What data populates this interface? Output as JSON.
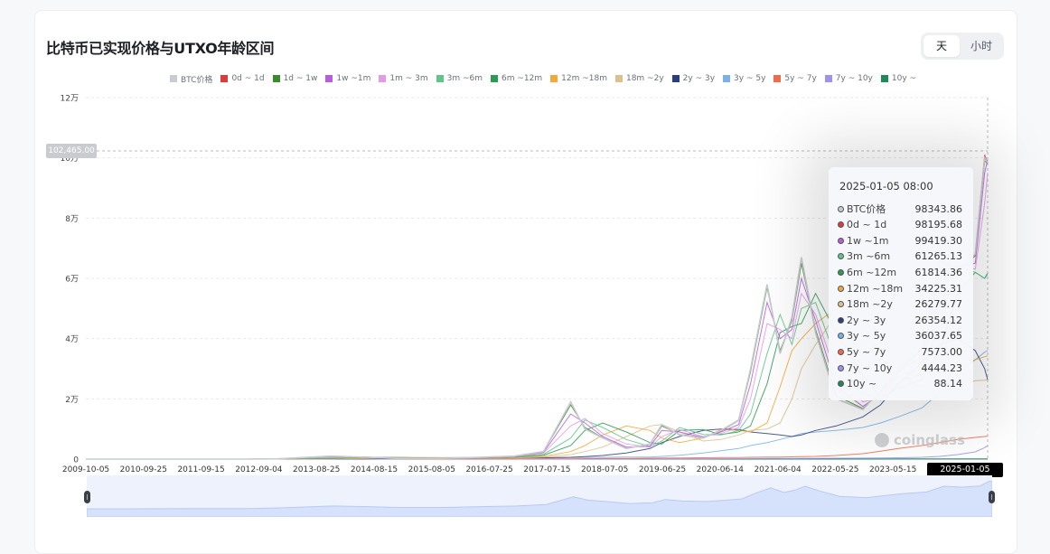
{
  "page": {
    "title": "比特币已实现价格与UTXO年龄区间",
    "toggle": [
      {
        "label": "天",
        "active": true
      },
      {
        "label": "小时",
        "active": false
      }
    ],
    "watermark": "coinglass"
  },
  "tooltip": {
    "date": "2025-01-05 08:00",
    "rows": [
      {
        "label": "BTC价格",
        "value": "98343.86",
        "color": "#c8cbd0"
      },
      {
        "label": "0d ~ 1d",
        "value": "98195.68",
        "color": "#e03b3b"
      },
      {
        "label": "1w ~1m",
        "value": "99419.30",
        "color": "#b85de0"
      },
      {
        "label": "3m ~6m",
        "value": "61265.13",
        "color": "#5fc58a"
      },
      {
        "label": "6m ~12m",
        "value": "61814.36",
        "color": "#2b9a55"
      },
      {
        "label": "12m ~18m",
        "value": "34225.31",
        "color": "#f2a93a"
      },
      {
        "label": "18m ~2y",
        "value": "26279.77",
        "color": "#dcc08e"
      },
      {
        "label": "2y ~ 3y",
        "value": "26354.12",
        "color": "#2b3f80"
      },
      {
        "label": "3y ~ 5y",
        "value": "36037.65",
        "color": "#7ab2e8"
      },
      {
        "label": "5y ~ 7y",
        "value": "7573.00",
        "color": "#f06a4c"
      },
      {
        "label": "7y ~ 10y",
        "value": "4444.23",
        "color": "#a090f0"
      },
      {
        "label": "10y ~",
        "value": "88.14",
        "color": "#1e8a5a"
      }
    ]
  },
  "cursor": {
    "price_label": "102,465.00",
    "date_label": "2025-01-05 08:00"
  },
  "chart_data": {
    "type": "line",
    "title": "比特币已实现价格与UTXO年龄区间",
    "xlabel": "",
    "ylabel": "",
    "ylim": [
      0,
      120000
    ],
    "y_ticks": [
      {
        "value": 0,
        "label": "0"
      },
      {
        "value": 20000,
        "label": "2万"
      },
      {
        "value": 40000,
        "label": "4万"
      },
      {
        "value": 60000,
        "label": "6万"
      },
      {
        "value": 80000,
        "label": "8万"
      },
      {
        "value": 100000,
        "label": "10万"
      },
      {
        "value": 120000,
        "label": "12万"
      }
    ],
    "x_ticks": [
      "2009-10-05",
      "2010-09-25",
      "2011-09-15",
      "2012-09-04",
      "2013-08-25",
      "2014-08-15",
      "2015-08-05",
      "2016-07-25",
      "2017-07-15",
      "2018-07-05",
      "2019-06-25",
      "2020-06-14",
      "2021-06-04",
      "2022-05-25",
      "2023-05-15"
    ],
    "x_range": [
      "2009-10-05",
      "2025-01-05"
    ],
    "grid": true,
    "legend_position": "top",
    "x": [
      2009.76,
      2010.5,
      2011.5,
      2012.5,
      2013.0,
      2013.9,
      2014.5,
      2015.0,
      2015.8,
      2016.5,
      2017.0,
      2017.5,
      2017.96,
      2018.2,
      2018.5,
      2018.9,
      2019.3,
      2019.5,
      2019.8,
      2020.2,
      2020.5,
      2020.8,
      2021.0,
      2021.28,
      2021.5,
      2021.7,
      2021.86,
      2022.1,
      2022.45,
      2022.9,
      2023.2,
      2023.5,
      2023.9,
      2024.2,
      2024.5,
      2024.8,
      2024.96,
      2025.01
    ],
    "series": [
      {
        "name": "BTC价格",
        "color": "#c8cbd0",
        "values": [
          0,
          0.1,
          5,
          12,
          100,
          1000,
          600,
          250,
          230,
          650,
          1000,
          2500,
          19000,
          10000,
          7000,
          3500,
          5000,
          11500,
          8000,
          7000,
          9500,
          13000,
          30000,
          58000,
          35000,
          47000,
          67000,
          42000,
          20000,
          16500,
          23000,
          30000,
          37000,
          67000,
          62000,
          68000,
          100000,
          98343
        ]
      },
      {
        "name": "0d ~ 1d",
        "color": "#e03b3b",
        "values": [
          0,
          0.1,
          5,
          12,
          100,
          1000,
          600,
          250,
          230,
          650,
          1000,
          2500,
          19000,
          10000,
          7000,
          3500,
          5000,
          11500,
          8000,
          7000,
          9500,
          13000,
          30000,
          58000,
          35000,
          47000,
          67000,
          42000,
          20000,
          16500,
          23000,
          30000,
          37000,
          67000,
          62000,
          68000,
          101000,
          98195
        ]
      },
      {
        "name": "1d ~ 1w",
        "color": "#3d8a2e",
        "values": [
          0,
          0.1,
          5,
          12,
          100,
          950,
          620,
          260,
          235,
          640,
          980,
          2450,
          18000,
          10500,
          7100,
          3600,
          4900,
          11000,
          8200,
          7100,
          9300,
          12800,
          29000,
          57000,
          36000,
          46000,
          65000,
          43000,
          21000,
          16800,
          22500,
          29800,
          36500,
          66000,
          62500,
          67500,
          99000,
          98000
        ]
      },
      {
        "name": "1w ~1m",
        "color": "#b85de0",
        "values": [
          0,
          0.1,
          4,
          11,
          80,
          800,
          650,
          300,
          240,
          600,
          900,
          2200,
          15000,
          12000,
          7500,
          4000,
          4300,
          9500,
          9000,
          7200,
          9000,
          11500,
          25000,
          52000,
          40000,
          43000,
          60000,
          46000,
          24000,
          17500,
          21500,
          29000,
          34000,
          62000,
          64000,
          65000,
          95000,
          99419
        ]
      },
      {
        "name": "1m ~ 3m",
        "color": "#e39be8",
        "values": [
          0,
          0.1,
          3,
          10,
          60,
          600,
          700,
          350,
          250,
          550,
          850,
          2000,
          11000,
          13500,
          8500,
          5000,
          4000,
          7500,
          9800,
          7500,
          8500,
          10500,
          20000,
          45000,
          43000,
          40000,
          55000,
          48000,
          28000,
          19000,
          20500,
          27500,
          31000,
          55000,
          65000,
          63000,
          85000,
          95000
        ]
      },
      {
        "name": "3m ~6m",
        "color": "#5fc58a",
        "values": [
          0,
          0.1,
          2,
          8,
          40,
          400,
          700,
          450,
          280,
          500,
          800,
          1600,
          7000,
          13000,
          10500,
          6500,
          4200,
          6000,
          10500,
          8200,
          8000,
          9500,
          15000,
          35000,
          48000,
          38000,
          50000,
          52000,
          33000,
          22000,
          19500,
          25500,
          28500,
          45000,
          64000,
          62000,
          60000,
          61265
        ]
      },
      {
        "name": "6m ~12m",
        "color": "#2b9a55",
        "values": [
          0,
          0,
          1,
          6,
          25,
          250,
          600,
          550,
          340,
          420,
          700,
          1300,
          4500,
          9500,
          12000,
          9000,
          5500,
          5000,
          9500,
          9800,
          8200,
          9000,
          11000,
          25000,
          42000,
          44000,
          45000,
          55000,
          42000,
          28000,
          20500,
          23500,
          26500,
          36000,
          55000,
          62000,
          60000,
          61814
        ]
      },
      {
        "name": "12m ~18m",
        "color": "#f2a93a",
        "values": [
          0,
          0,
          0.5,
          4,
          15,
          120,
          350,
          600,
          450,
          380,
          500,
          900,
          2500,
          4500,
          8000,
          11000,
          9500,
          7000,
          5500,
          7000,
          9800,
          9500,
          9000,
          12000,
          24000,
          36000,
          40000,
          45000,
          50000,
          44000,
          34000,
          27000,
          24000,
          25000,
          30000,
          33000,
          34000,
          34225
        ]
      },
      {
        "name": "18m ~2y",
        "color": "#dcc08e",
        "values": [
          0,
          0,
          0.3,
          3,
          10,
          60,
          200,
          450,
          550,
          400,
          400,
          700,
          1500,
          2500,
          4000,
          7500,
          11000,
          11500,
          9000,
          6000,
          6500,
          8000,
          9500,
          10000,
          12000,
          20000,
          30000,
          38000,
          48000,
          50000,
          46000,
          38000,
          30000,
          26000,
          25000,
          26000,
          26200,
          26280
        ]
      },
      {
        "name": "2y ~ 3y",
        "color": "#2b3f80",
        "values": [
          0,
          0,
          0.1,
          2,
          6,
          30,
          90,
          200,
          450,
          550,
          500,
          450,
          600,
          800,
          1200,
          2000,
          3500,
          5500,
          7500,
          9500,
          10000,
          9800,
          9000,
          8500,
          8000,
          7500,
          8000,
          9500,
          11000,
          14000,
          18000,
          25000,
          32000,
          38000,
          40000,
          36000,
          30000,
          26354
        ]
      },
      {
        "name": "3y ~ 5y",
        "color": "#7ab2e8",
        "values": [
          0,
          0,
          0,
          1,
          3,
          10,
          25,
          60,
          120,
          200,
          300,
          400,
          500,
          550,
          600,
          650,
          700,
          900,
          1300,
          2000,
          2800,
          3500,
          4500,
          5500,
          6500,
          7500,
          8500,
          9000,
          9500,
          10500,
          12000,
          14000,
          17000,
          22000,
          28000,
          33000,
          35500,
          36038
        ]
      },
      {
        "name": "5y ~ 7y",
        "color": "#f06a4c",
        "values": [
          0,
          0,
          0,
          0,
          0,
          1,
          2,
          4,
          8,
          15,
          30,
          60,
          100,
          150,
          200,
          250,
          300,
          350,
          400,
          450,
          500,
          550,
          600,
          650,
          700,
          750,
          800,
          900,
          1200,
          1800,
          2600,
          3500,
          4500,
          5500,
          6500,
          7200,
          7500,
          7573
        ]
      },
      {
        "name": "7y ~ 10y",
        "color": "#a090f0",
        "values": [
          0,
          0,
          0,
          0,
          0,
          0,
          0,
          1,
          2,
          3,
          5,
          8,
          12,
          20,
          30,
          45,
          60,
          80,
          100,
          120,
          140,
          160,
          180,
          200,
          220,
          240,
          260,
          280,
          300,
          330,
          380,
          450,
          600,
          900,
          1500,
          2400,
          3800,
          4444
        ]
      },
      {
        "name": "10y ~",
        "color": "#1e8a5a",
        "values": [
          0,
          0,
          0,
          0,
          0,
          0,
          0,
          0,
          0,
          0,
          0,
          0,
          0.5,
          1,
          1.5,
          2,
          3,
          4,
          5,
          6,
          8,
          10,
          12,
          15,
          18,
          22,
          26,
          30,
          35,
          40,
          45,
          50,
          55,
          60,
          70,
          80,
          86,
          88
        ]
      }
    ]
  }
}
